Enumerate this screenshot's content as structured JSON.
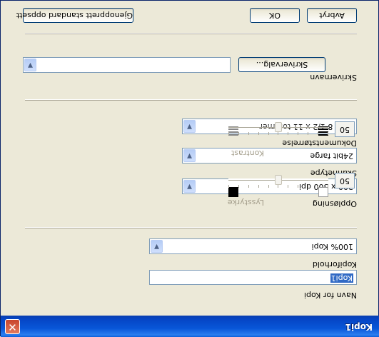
{
  "window": {
    "title": "Kopi1",
    "close_glyph": "✕"
  },
  "buttons": {
    "restore_defaults": "Gjenopprett standard oppsett",
    "ok": "OK",
    "cancel": "Avbryt",
    "select_printer": "Skrivervalg..."
  },
  "printer": {
    "label": "Skrivernavn",
    "value": ""
  },
  "scan": {
    "document_size": {
      "label": "Dokumentstørrelse",
      "value": "Brev 8 1/2 x 11 tommer"
    },
    "scan_type": {
      "label": "Skannetype",
      "value": "24bit farge"
    },
    "resolution": {
      "label": "Oppløsning",
      "value": "300 x 300 dpi"
    }
  },
  "contrast": {
    "label": "Kontrast",
    "value": "50",
    "level": 0.5
  },
  "brightness": {
    "label": "Lysstyrke",
    "value": "50",
    "level": 0.5
  },
  "copy": {
    "ratio": {
      "label": "Kopiforhold",
      "value": "100% Kopi"
    },
    "name": {
      "label": "Navn for Kopi",
      "value": "Kopi1"
    }
  },
  "icons": [
    "close-icon",
    "chevron-down-icon",
    "contrast-low-icon",
    "contrast-high-icon",
    "brightness-low-icon",
    "brightness-high-icon"
  ],
  "colors": {
    "titlebar": "#0054e3",
    "face": "#ece9d8",
    "selection": "#316ac5"
  }
}
